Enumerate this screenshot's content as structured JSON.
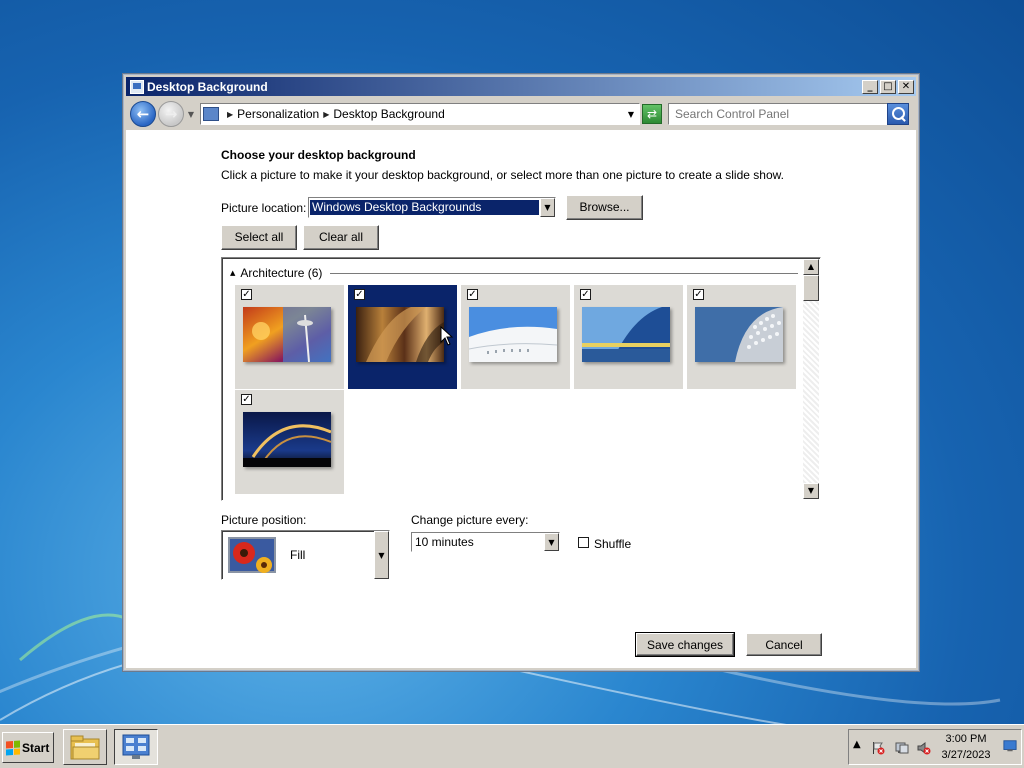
{
  "window": {
    "title": "Desktop Background",
    "controls": {
      "minimize": "_",
      "maximize": "□",
      "close": "✕"
    }
  },
  "address_bar": {
    "breadcrumbs": [
      "Personalization",
      "Desktop Background"
    ],
    "search_placeholder": "Search Control Panel"
  },
  "content": {
    "heading": "Choose your desktop background",
    "description": "Click a picture to make it your desktop background, or select more than one picture to create a slide show.",
    "picture_location_label": "Picture location:",
    "picture_location_value": "Windows Desktop Backgrounds",
    "browse_label": "Browse...",
    "select_all_label": "Select all",
    "clear_all_label": "Clear all",
    "group": {
      "label": "Architecture (6)",
      "pictures": [
        {
          "checked": true,
          "selected": false,
          "checkmark": "✓"
        },
        {
          "checked": true,
          "selected": true,
          "checkmark": "✓"
        },
        {
          "checked": true,
          "selected": false,
          "checkmark": "✓"
        },
        {
          "checked": true,
          "selected": false,
          "checkmark": "✓"
        },
        {
          "checked": true,
          "selected": false,
          "checkmark": "✓"
        },
        {
          "checked": true,
          "selected": false,
          "checkmark": "✓"
        }
      ]
    },
    "picture_position_label": "Picture position:",
    "picture_position_value": "Fill",
    "change_picture_label": "Change picture every:",
    "change_picture_value": "10 minutes",
    "shuffle_label": "Shuffle",
    "shuffle_checked": false,
    "save_label": "Save changes",
    "cancel_label": "Cancel"
  },
  "taskbar": {
    "start_label": "Start",
    "clock_time": "3:00 PM",
    "clock_date": "3/27/2023"
  },
  "colors": {
    "selection": "#0a246a",
    "window_face": "#d4d0c8"
  }
}
